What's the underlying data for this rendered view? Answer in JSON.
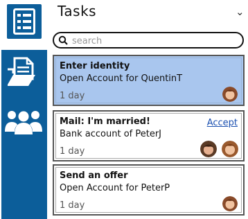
{
  "header": {
    "title": "Tasks",
    "chevron_icon": "chevron-down-icon"
  },
  "search": {
    "placeholder": "search",
    "value": ""
  },
  "rail": {
    "items": [
      {
        "name": "tasks-list-icon",
        "selected": true
      },
      {
        "name": "document-folder-icon",
        "selected": false
      },
      {
        "name": "people-group-icon",
        "selected": false
      }
    ]
  },
  "colors": {
    "rail": "#0c5e9a",
    "selected_card": "#a9c6ee",
    "link": "#1a4fb0"
  },
  "tasks": [
    {
      "title": "Enter identity",
      "subtitle": "Open Account for QuentinT",
      "age": "1 day",
      "action": "",
      "avatars": 1,
      "selected": true
    },
    {
      "title": "Mail: I'm married!",
      "subtitle": "Bank account of PeterJ",
      "age": "1 day",
      "action": "Accept",
      "avatars": 2,
      "selected": false
    },
    {
      "title": "Send an offer",
      "subtitle": "Open Account for PeterP",
      "age": "1 day",
      "action": "",
      "avatars": 1,
      "selected": false
    }
  ]
}
